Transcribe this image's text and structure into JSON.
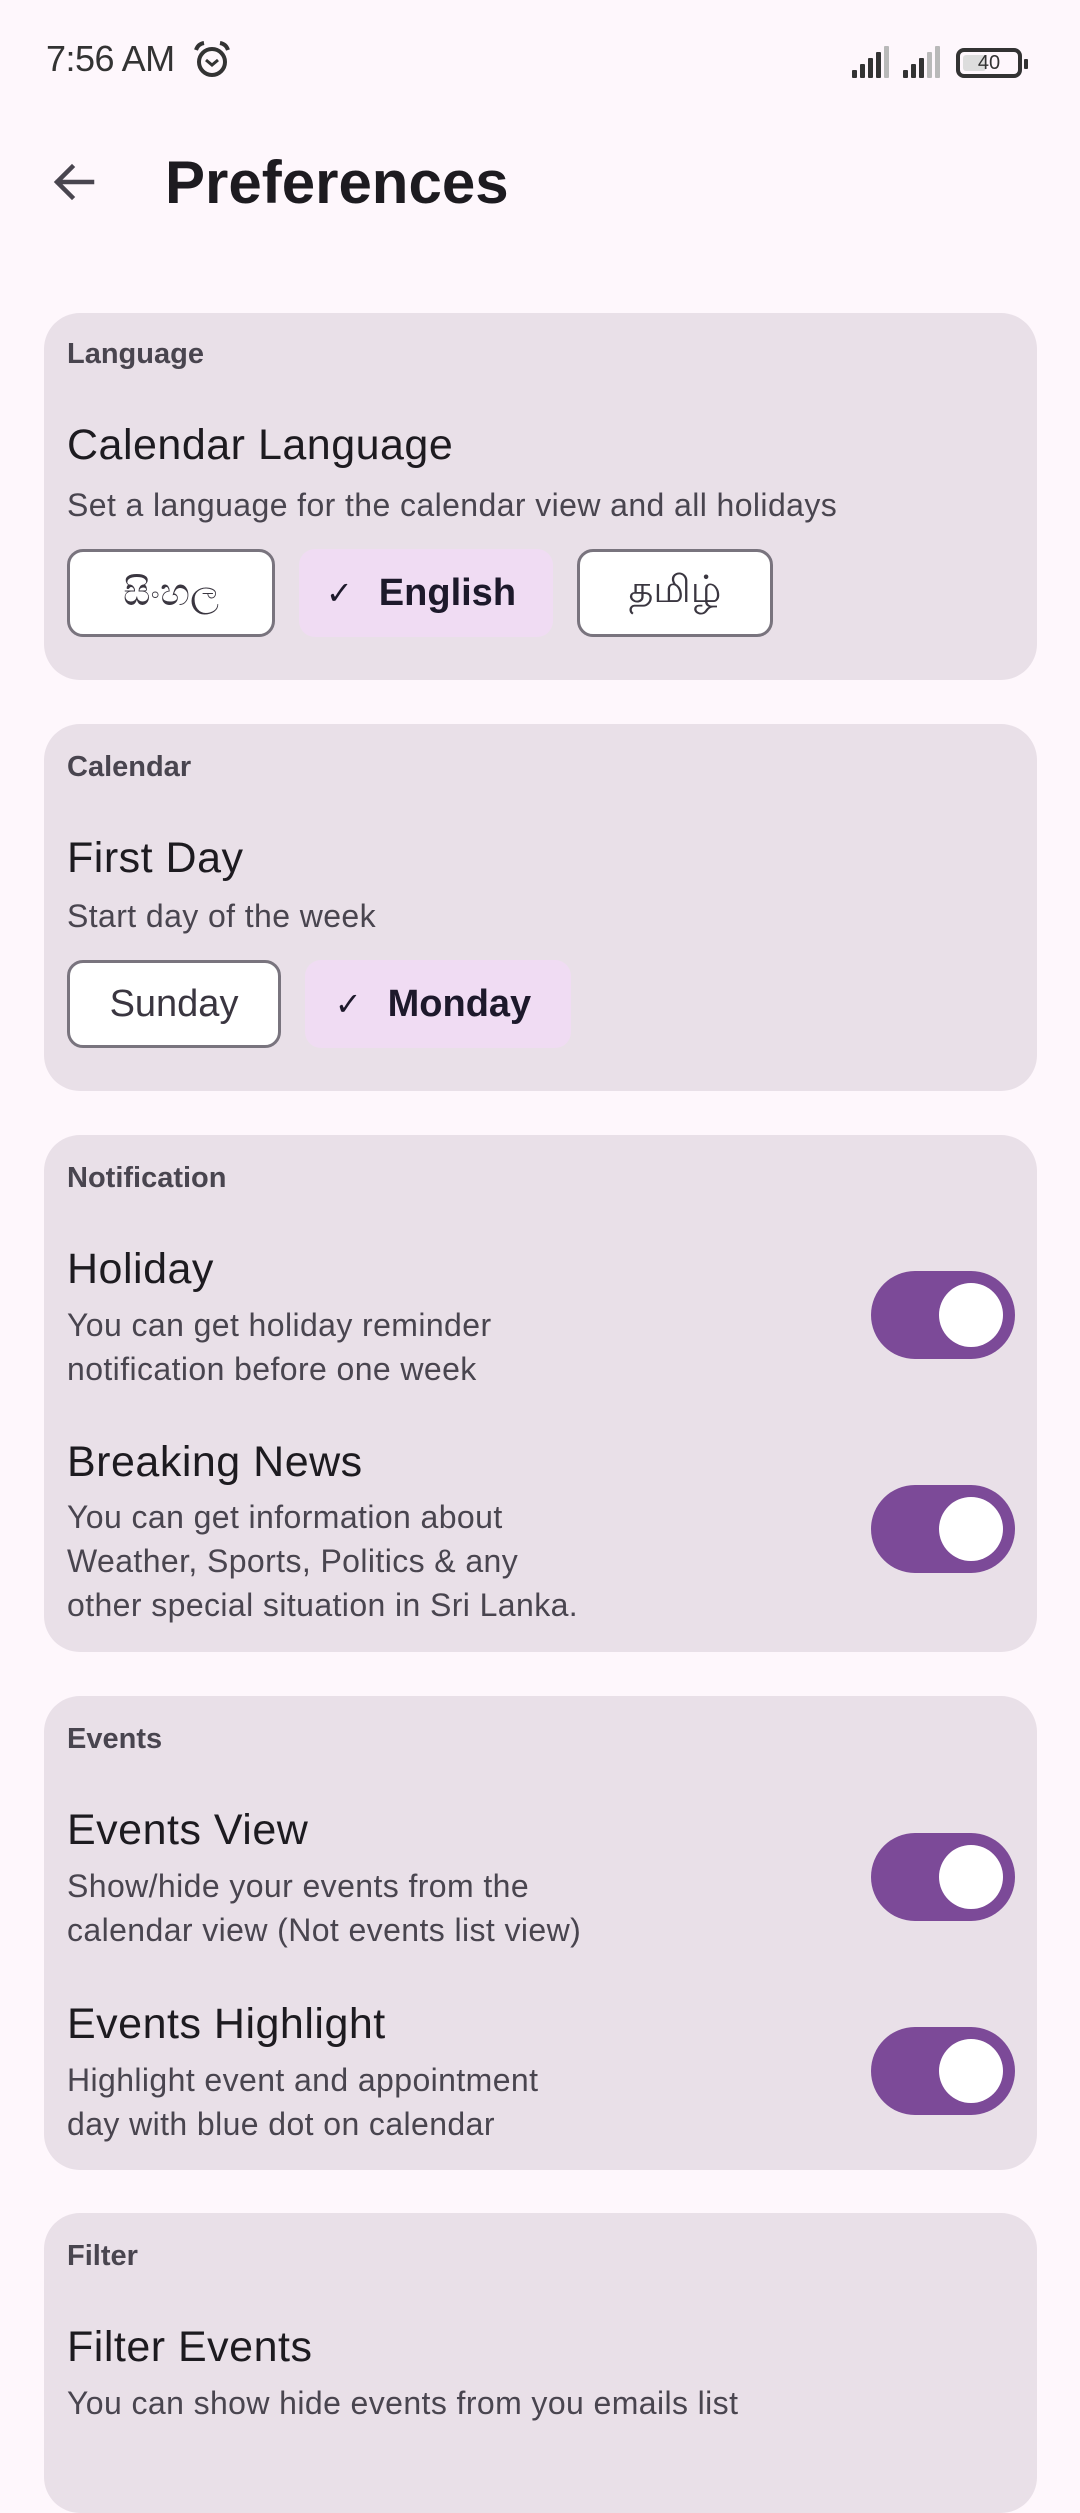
{
  "status_bar": {
    "time": "7:56 AM",
    "alarm_icon": "alarm-clock-icon",
    "signal_1_bars": 4,
    "signal_2_bars": 3,
    "signal_max_bars": 5,
    "battery_level": "40"
  },
  "app_bar": {
    "back_icon": "arrow-back-icon",
    "title": "Preferences"
  },
  "colors": {
    "accent": "#7c4a98",
    "card_bg": "#e9e0e8",
    "selected_chip_bg": "#f0dcf3",
    "page_bg": "#fef7fc"
  },
  "sections": {
    "language": {
      "header": "Language",
      "title": "Calendar Language",
      "description": "Set a language for the calendar view and all holidays",
      "options": [
        {
          "label": "සිංහල",
          "selected": false
        },
        {
          "label": "English",
          "selected": true
        },
        {
          "label": "தமிழ்",
          "selected": false
        }
      ]
    },
    "calendar": {
      "header": "Calendar",
      "title": "First Day",
      "description": "Start day of the week",
      "options": [
        {
          "label": "Sunday",
          "selected": false
        },
        {
          "label": "Monday",
          "selected": true
        }
      ]
    },
    "notification": {
      "header": "Notification",
      "items": [
        {
          "title": "Holiday",
          "description_lines": [
            "You can get holiday reminder",
            "notification before one week"
          ],
          "enabled": true
        },
        {
          "title": "Breaking News",
          "description_lines": [
            "You can get information about",
            "Weather, Sports, Politics & any",
            "other special situation in Sri Lanka."
          ],
          "enabled": true
        }
      ]
    },
    "events": {
      "header": "Events",
      "items": [
        {
          "title": "Events View",
          "description_lines": [
            "Show/hide your events from the",
            "calendar view (Not events list view)"
          ],
          "enabled": true
        },
        {
          "title": "Events Highlight",
          "description_lines": [
            "Highlight event and appointment",
            "day with blue dot on calendar"
          ],
          "enabled": true
        }
      ]
    },
    "filter": {
      "header": "Filter",
      "title": "Filter Events",
      "description": "You can show hide events from you emails list"
    }
  },
  "check_glyph": "✓"
}
